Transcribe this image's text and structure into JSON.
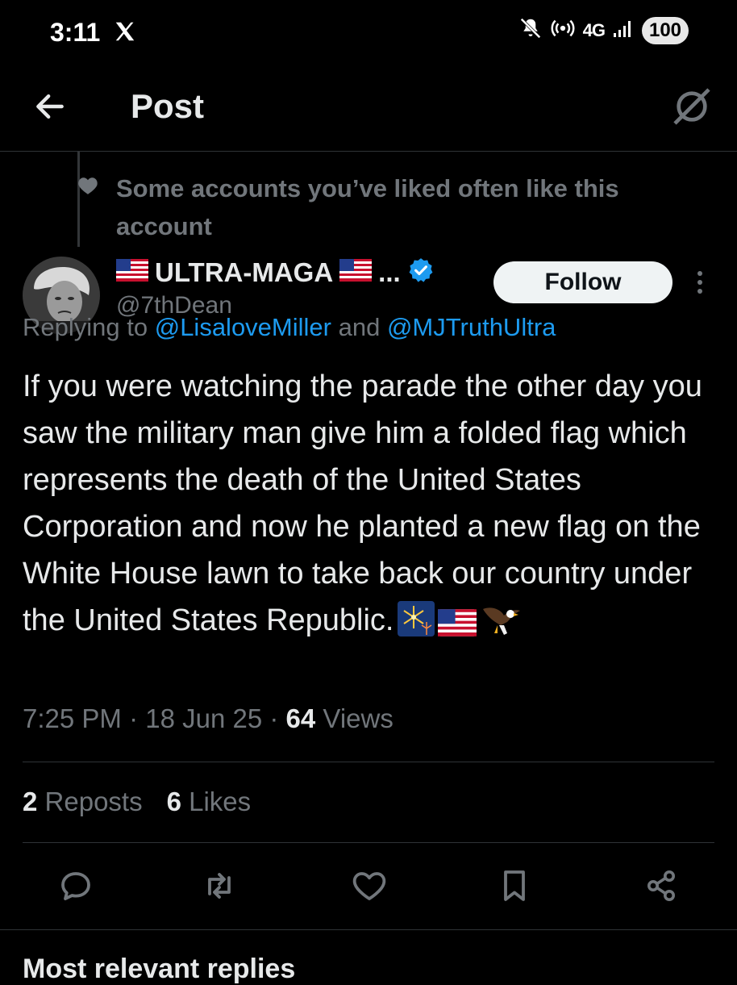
{
  "status_bar": {
    "time": "3:11",
    "network": "4G",
    "battery": "100"
  },
  "header": {
    "title": "Post"
  },
  "social_context": {
    "text": "Some accounts you’ve liked often like this account"
  },
  "author": {
    "display_name": "ULTRA-MAGA",
    "name_suffix": "...",
    "handle": "@7thDean",
    "verified": true
  },
  "follow_button": {
    "label": "Follow"
  },
  "replying": {
    "prefix": "Replying to ",
    "mention_1": "@LisaloveMiller",
    "joiner": " and ",
    "mention_2": "@MJTruthUltra"
  },
  "post": {
    "text": "If you were watching the parade the other day you saw the military man give him a folded flag which represents the death of the United States Corporation and now he planted a new flag on the White House lawn to take back our country under the United States Republic."
  },
  "meta": {
    "time": "7:25 PM",
    "sep1": " · ",
    "date": "18 Jun 25",
    "sep2": " · ",
    "views_count": "64",
    "views_label": " Views"
  },
  "stats": {
    "reposts_count": "2",
    "reposts_label": " Reposts",
    "likes_count": "6",
    "likes_label": " Likes"
  },
  "replies": {
    "heading": "Most relevant replies"
  },
  "colors": {
    "background": "#000000",
    "text_primary": "#e7e9ea",
    "text_secondary": "#71767b",
    "link": "#1d9bf0",
    "verified": "#1d9bf0",
    "divider": "#2f3336"
  }
}
